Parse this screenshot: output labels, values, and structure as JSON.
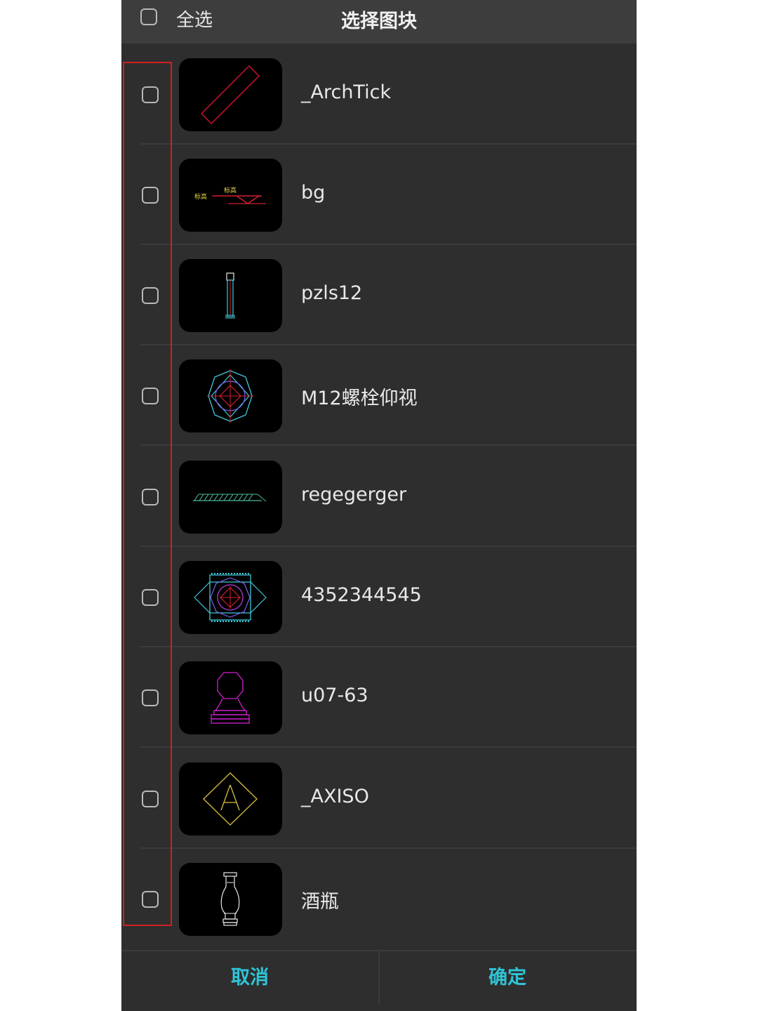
{
  "header": {
    "select_all_label": "全选",
    "title": "选择图块"
  },
  "items": [
    {
      "name": "_ArchTick",
      "thumb_icon": "arch-tick-icon"
    },
    {
      "name": "bg",
      "thumb_icon": "elevation-mark-icon"
    },
    {
      "name": "pzls12",
      "thumb_icon": "bolt-side-icon"
    },
    {
      "name": "M12螺栓仰视",
      "thumb_icon": "bolt-bottom-view-icon"
    },
    {
      "name": "regegerger",
      "thumb_icon": "hatch-line-icon"
    },
    {
      "name": "4352344545",
      "thumb_icon": "bolt-assembly-icon"
    },
    {
      "name": "u07-63",
      "thumb_icon": "baluster-icon"
    },
    {
      "name": "_AXISO",
      "thumb_icon": "axis-marker-icon"
    },
    {
      "name": "酒瓶",
      "thumb_icon": "bottle-icon"
    }
  ],
  "thumb_texts": {
    "bg_left": "标高",
    "bg_top": "标高"
  },
  "footer": {
    "cancel_label": "取消",
    "confirm_label": "确定"
  },
  "colors": {
    "background": "#2e2e2e",
    "header": "#3d3d3d",
    "accent": "#2ec4d6",
    "highlight": "#d02020"
  }
}
